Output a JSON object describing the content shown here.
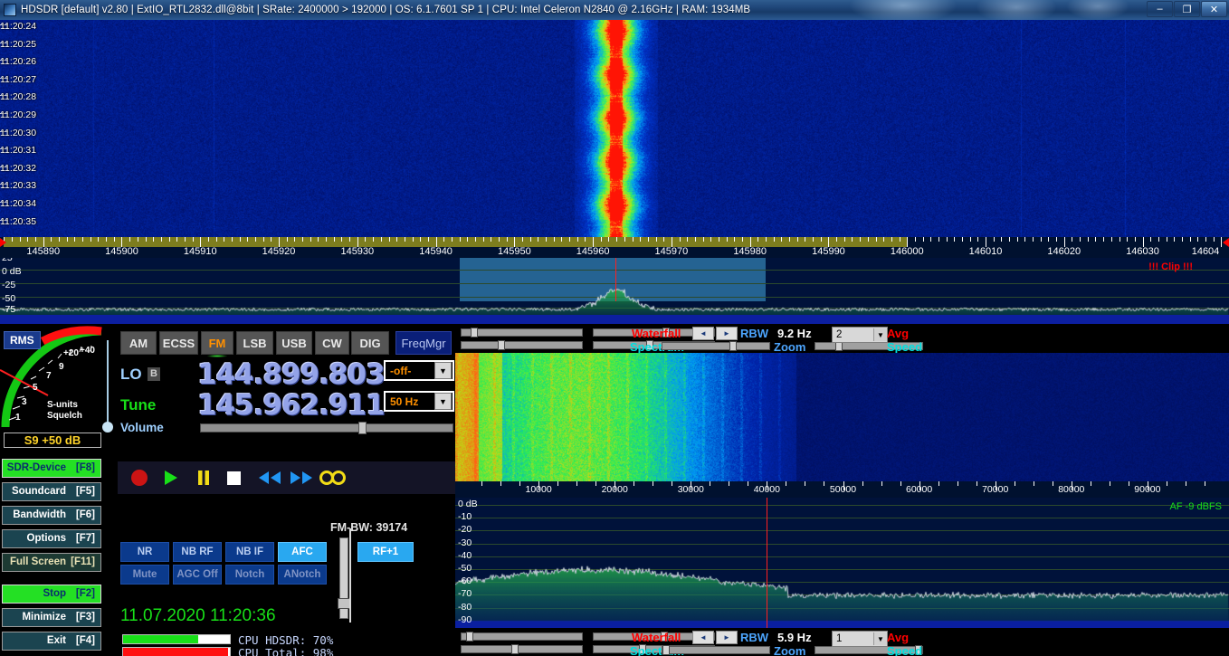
{
  "titlebar": {
    "icon": "hdsdr-icon",
    "text": "HDSDR  [default]  v2.80   |   ExtIO_RTL2832.dll@8bit   |   SRate: 2400000 > 192000   |   OS: 6.1.7601 SP 1   |   CPU: Intel Celeron  N2840  @ 2.16GHz   |   RAM: 1934MB",
    "minimize": "–",
    "maximize": "❐",
    "close": "✕"
  },
  "waterfall_main": {
    "timestamps": [
      "11:20:24",
      "11:20:25",
      "11:20:26",
      "11:20:27",
      "11:20:28",
      "11:20:29",
      "11:20:30",
      "11:20:31",
      "11:20:32",
      "11:20:33",
      "11:20:34",
      "11:20:35"
    ]
  },
  "freq_scale": {
    "labels": [
      "145890",
      "145900",
      "145910",
      "145920",
      "145930",
      "145940",
      "145950",
      "145960",
      "145970",
      "145980",
      "145990",
      "146000",
      "146010",
      "146020",
      "146030",
      "14604"
    ],
    "start_khz": 145884.5,
    "end_khz": 146041.0
  },
  "rf_spectrum": {
    "db_labels": [
      "25",
      "0 dB",
      "-25",
      "-50",
      "-75"
    ],
    "clip": "!!! Clip !!!"
  },
  "smeter": {
    "mode_badge": "RMS",
    "scale_ticks": [
      "1",
      "3",
      "5",
      "7",
      "9",
      "+20",
      "+40"
    ],
    "caption_line1": "S-units",
    "caption_line2": "Squelch",
    "readout": "S9 +50 dB"
  },
  "sidebar": {
    "items": [
      {
        "label": "SDR-Device",
        "key": "[F8]",
        "style": "green"
      },
      {
        "label": "Soundcard",
        "key": "[F5]",
        "style": "normal"
      },
      {
        "label": "Bandwidth",
        "key": "[F6]",
        "style": "normal"
      },
      {
        "label": "Options",
        "key": "[F7]",
        "style": "normal"
      },
      {
        "label": "Full Screen",
        "key": "[F11]",
        "style": "fs"
      },
      {
        "label": "Stop",
        "key": "[F2]",
        "style": "green"
      },
      {
        "label": "Minimize",
        "key": "[F3]",
        "style": "normal"
      },
      {
        "label": "Exit",
        "key": "[F4]",
        "style": "normal"
      }
    ]
  },
  "modes": {
    "buttons": [
      {
        "label": "AM",
        "active": false
      },
      {
        "label": "ECSS",
        "active": false
      },
      {
        "label": "FM",
        "active": true
      },
      {
        "label": "LSB",
        "active": false
      },
      {
        "label": "USB",
        "active": false
      },
      {
        "label": "CW",
        "active": false
      },
      {
        "label": "DIG",
        "active": false
      }
    ],
    "freqmgr": "FreqMgr"
  },
  "frequency": {
    "lo_label": "LO",
    "lo_band": "B",
    "lo_value": "144.899.803",
    "lo_dropdown": "-off-",
    "tune_label": "Tune",
    "tune_value": "145.962.911",
    "tune_dropdown": "50 Hz",
    "volume_label": "Volume"
  },
  "transport": {
    "buttons": [
      "record-button",
      "play-button",
      "pause-button",
      "stop-button",
      "rewind-button",
      "forward-button",
      "loop-button"
    ]
  },
  "dsp": {
    "fm_bw": "FM-BW: 39174",
    "row1": [
      {
        "label": "NR",
        "active": false
      },
      {
        "label": "NB RF",
        "active": false
      },
      {
        "label": "NB IF",
        "active": false
      },
      {
        "label": "AFC",
        "active": true
      }
    ],
    "row2": [
      {
        "label": "Mute",
        "active": false
      },
      {
        "label": "AGC Off",
        "active": false
      },
      {
        "label": "Notch",
        "active": false
      },
      {
        "label": "ANotch",
        "active": false
      }
    ],
    "rf_gain": {
      "label": "RF+1",
      "active": true
    }
  },
  "status": {
    "datetime": "11.07.2020 11:20:36",
    "cpu_hdsdr": "CPU HDSDR: 70%",
    "cpu_total": "CPU Total: 98%",
    "cpu_hdsdr_pct": 70,
    "cpu_total_pct": 98
  },
  "top_controls": {
    "waterfall_label": "Waterfall",
    "spectrum_label": "Spectrum",
    "rbw_label": "RBW",
    "rbw_value": "9.2 Hz",
    "zoom_label": "Zoom",
    "avg_label": "Avg",
    "speed_label": "Speed",
    "avg_select": "2",
    "left_arrow": "◄",
    "right_arrow": "►",
    "dropdown_arrow": "▼"
  },
  "bottom_controls": {
    "waterfall_label": "Waterfall",
    "spectrum_label": "Spectrum",
    "rbw_label": "RBW",
    "rbw_value": "5.9 Hz",
    "zoom_label": "Zoom",
    "avg_label": "Avg",
    "speed_label": "Speed",
    "avg_select": "1",
    "left_arrow": "◄",
    "right_arrow": "►",
    "dropdown_arrow": "▼"
  },
  "af_scale": {
    "labels": [
      "10000",
      "20000",
      "30000",
      "40000",
      "50000",
      "60000",
      "70000",
      "80000",
      "90000"
    ]
  },
  "af_spectrum": {
    "db_labels": [
      "0 dB",
      "-10",
      "-20",
      "-30",
      "-40",
      "-50",
      "-60",
      "-70",
      "-80",
      "-90"
    ],
    "af_level": "AF  -9 dBFS"
  },
  "colors": {
    "accent_orange": "#ff9000",
    "accent_green": "#18e018",
    "accent_cyan": "#29a8f0",
    "accent_red": "#ff0000",
    "waterfall_blue": "#001a66"
  }
}
